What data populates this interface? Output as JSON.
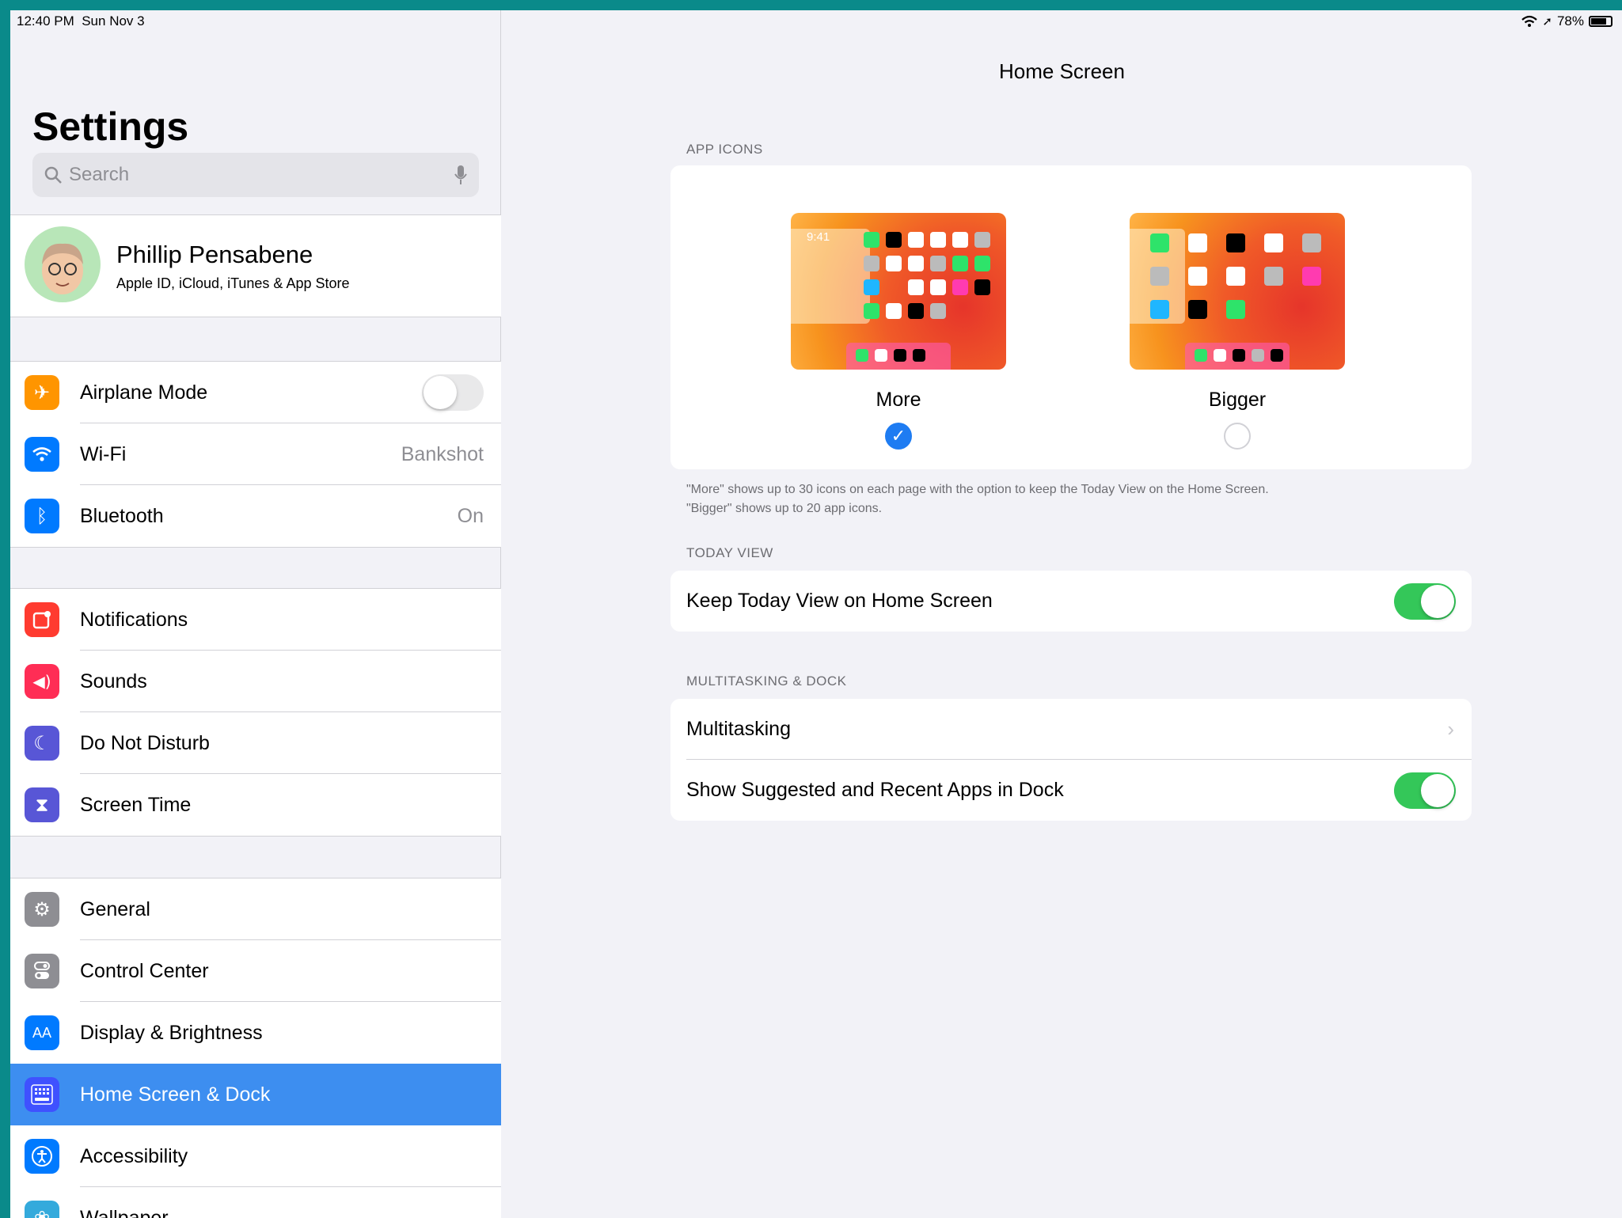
{
  "status": {
    "time": "12:40 PM",
    "date": "Sun Nov 3",
    "battery": "78%",
    "battery_level": 0.78
  },
  "sidebar": {
    "title": "Settings",
    "search_placeholder": "Search",
    "profile": {
      "name": "Phillip Pensabene",
      "subtitle": "Apple ID, iCloud, iTunes & App Store"
    },
    "group1": [
      {
        "label": "Airplane Mode",
        "icon": "airplane-icon",
        "color": "#ff9500"
      },
      {
        "label": "Wi-Fi",
        "value": "Bankshot",
        "icon": "wifi-icon",
        "color": "#007aff"
      },
      {
        "label": "Bluetooth",
        "value": "On",
        "icon": "bluetooth-icon",
        "color": "#007aff"
      }
    ],
    "group2": [
      {
        "label": "Notifications",
        "icon": "notifications-icon",
        "color": "#ff3b30"
      },
      {
        "label": "Sounds",
        "icon": "sounds-icon",
        "color": "#ff2d55"
      },
      {
        "label": "Do Not Disturb",
        "icon": "moon-icon",
        "color": "#5856d6"
      },
      {
        "label": "Screen Time",
        "icon": "hourglass-icon",
        "color": "#5856d6"
      }
    ],
    "group3": [
      {
        "label": "General",
        "icon": "gear-icon",
        "color": "#8e8e93"
      },
      {
        "label": "Control Center",
        "icon": "control-center-icon",
        "color": "#8e8e93"
      },
      {
        "label": "Display & Brightness",
        "icon": "display-icon",
        "color": "#007aff"
      },
      {
        "label": "Home Screen & Dock",
        "icon": "home-screen-icon",
        "color": "#3f51ff"
      },
      {
        "label": "Accessibility",
        "icon": "accessibility-icon",
        "color": "#007aff"
      },
      {
        "label": "Wallpaper",
        "icon": "wallpaper-icon",
        "color": "#34aadc"
      }
    ]
  },
  "detail": {
    "title": "Home Screen",
    "app_icons_header": "APP ICONS",
    "option_more": "More",
    "option_bigger": "Bigger",
    "preview_time": "9:41",
    "footer_line1": "\"More\" shows up to 30 icons on each page with the option to keep the Today View on the Home Screen.",
    "footer_line2": "\"Bigger\" shows up to 20 app icons.",
    "today_header": "TODAY VIEW",
    "today_row": "Keep Today View on Home Screen",
    "multitasking_header": "MULTITASKING & DOCK",
    "multitasking_row": "Multitasking",
    "suggested_row": "Show Suggested and Recent Apps in Dock"
  }
}
